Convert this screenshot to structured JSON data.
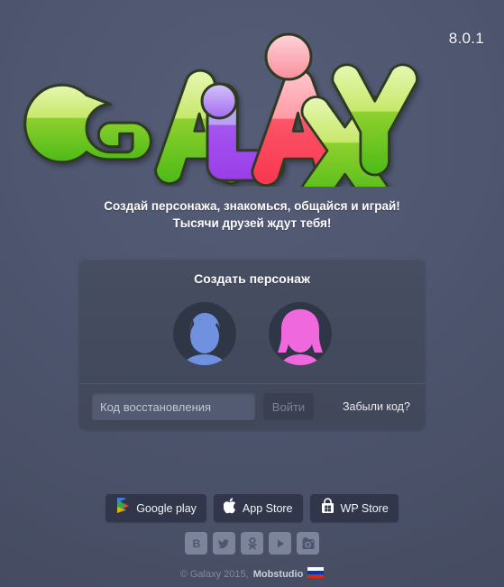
{
  "app": {
    "version": "8.0.1",
    "logo_text": "Galaxy",
    "logo_letters": [
      {
        "char": "G",
        "color": "green"
      },
      {
        "char": "A",
        "color": "green"
      },
      {
        "char": "L",
        "color": "purple"
      },
      {
        "char": "A",
        "color": "pink"
      },
      {
        "char": "X",
        "color": "green"
      },
      {
        "char": "Y",
        "color": "green"
      }
    ],
    "colors": {
      "background": "#4e5670",
      "panel": "#434a5e",
      "logo_green_light": "#d9f08c",
      "logo_green_dark": "#4cba17",
      "logo_purple_light": "#b79ff2",
      "logo_purple_dark": "#9a3de8",
      "logo_pink_light": "#ffb3ba",
      "logo_pink_dark": "#f8364f",
      "avatar_male": "#6f91e0",
      "avatar_female": "#ef68dd",
      "avatar_bg": "#2f3645"
    }
  },
  "tagline": {
    "line1": "Создай персонажа, знакомься, общайся и играй!",
    "line2": "Тысячи друзей ждут тебя!"
  },
  "panel": {
    "title": "Создать персонаж",
    "avatars": [
      {
        "name": "male",
        "label": "Мужской персонаж"
      },
      {
        "name": "female",
        "label": "Женский персонаж"
      }
    ],
    "form": {
      "input_placeholder": "Код восстановления",
      "input_value": "",
      "login_button": "Войти",
      "forgot_link": "Забыли код?"
    }
  },
  "stores": [
    {
      "label": "Google play",
      "icon": "google-play-icon"
    },
    {
      "label": "App Store",
      "icon": "apple-icon"
    },
    {
      "label": "WP Store",
      "icon": "windows-store-icon"
    }
  ],
  "social": [
    {
      "name": "vkontakte",
      "icon": "vk-icon",
      "glyph": "В"
    },
    {
      "name": "twitter",
      "icon": "twitter-icon",
      "glyph": "t"
    },
    {
      "name": "odnoklassniki",
      "icon": "ok-icon",
      "glyph": "ОК"
    },
    {
      "name": "youtube",
      "icon": "youtube-icon",
      "glyph": "▶"
    },
    {
      "name": "instagram",
      "icon": "instagram-icon",
      "glyph": "◉"
    }
  ],
  "footer": {
    "copyright": "© Galaxy 2015,",
    "brand": "Mobstudio",
    "flag": "ru"
  }
}
